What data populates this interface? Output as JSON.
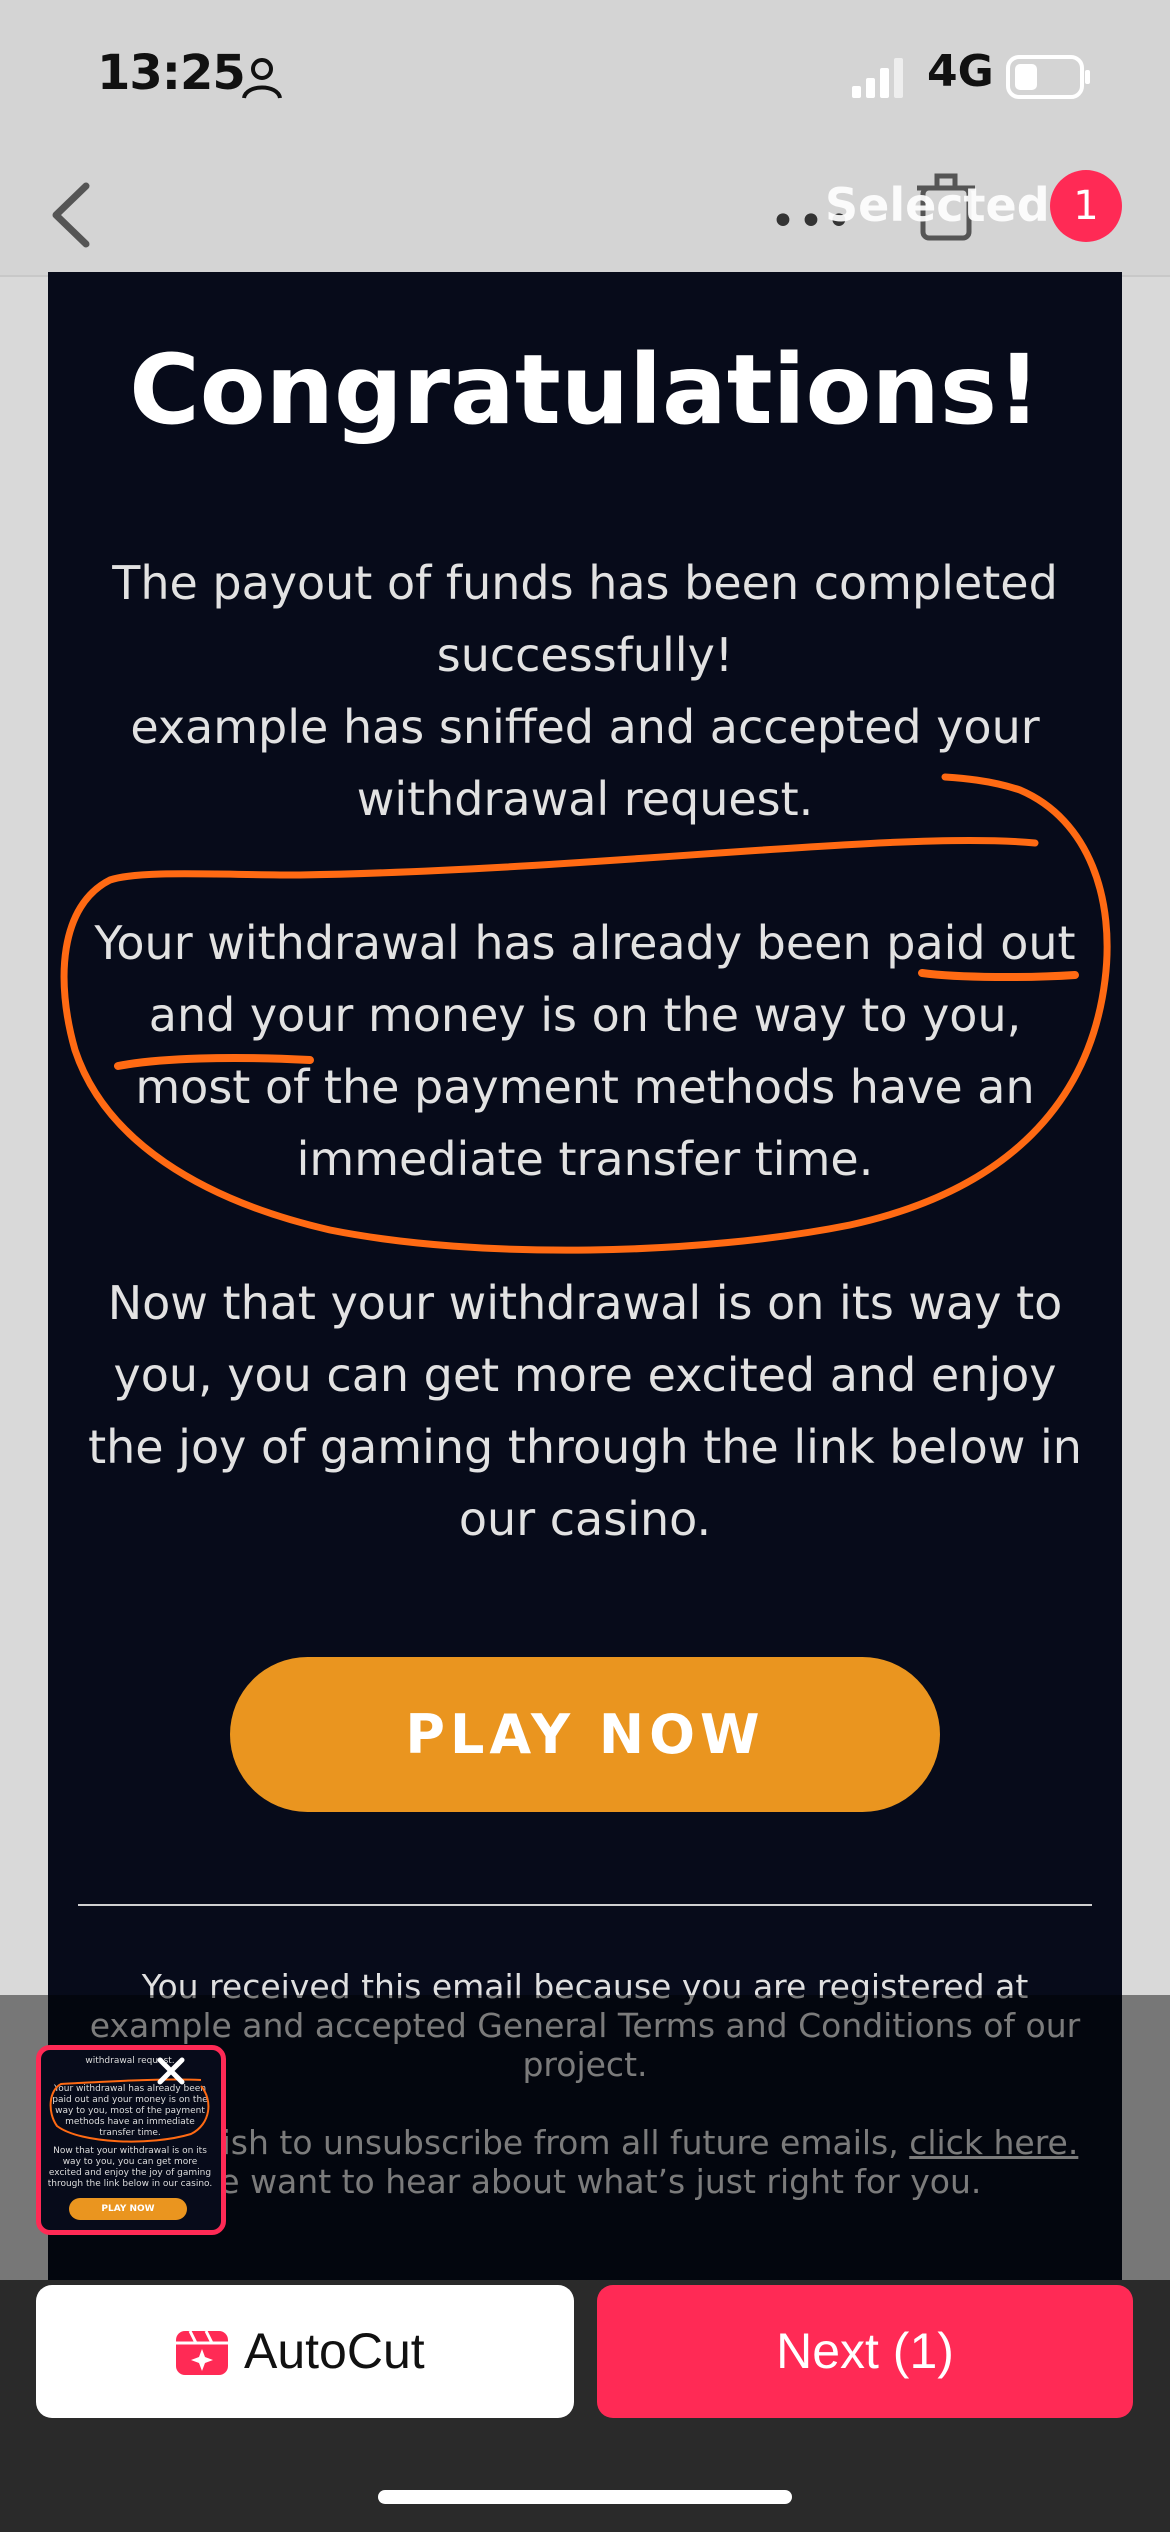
{
  "status_bar": {
    "time": "13:25",
    "network": "4G"
  },
  "nav": {
    "selected_label": "Selected",
    "selected_count": "1",
    "more": "•••"
  },
  "email": {
    "title": "Congratulations!",
    "paragraph1": "The payout of funds has been completed successfully!\nexample has sniffed and accepted your withdrawal request.",
    "paragraph2": "Your withdrawal has already been paid out and your money is on the way to you, most of the payment methods have an immediate transfer time.",
    "paragraph3": "Now that your withdrawal is on its way to you, you can get more excited and enjoy the joy of gaming through the link below in our casino.",
    "play_button": "PLAY NOW",
    "footer_line1": "You received this email because you are registered at example and accepted General Terms and Conditions of our project.",
    "footer_line2_start": "If you wish to unsubscribe from all future emails,",
    "footer_link": "click here.",
    "footer_line2_end": "We want to hear about what’s just right for you."
  },
  "thumbnail": {
    "line1": "withdrawal request.",
    "line2": "Your withdrawal has already been paid out and your money is on the way to you, most of the payment methods have an immediate transfer time.",
    "line3": "Now that your withdrawal is on its way to you, you can get more excited and enjoy the joy of gaming through the link below in our casino.",
    "button": "PLAY NOW"
  },
  "bottom": {
    "autocut_label": "AutoCut",
    "next_label": "Next (1)"
  },
  "colors": {
    "accent": "#ff2a55",
    "button_orange": "#ea951f",
    "email_bg": "#070b1a",
    "annotation": "#ff6a13"
  }
}
